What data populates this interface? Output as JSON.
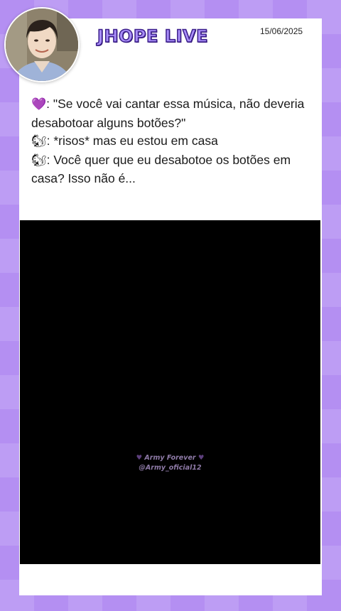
{
  "header": {
    "title": "JHOPE LIVE",
    "date": "15/06/2025"
  },
  "post": {
    "lines": [
      {
        "icon": "💜",
        "icon_name": "purple-heart-icon",
        "text": ": \"Se você vai cantar essa música, não deveria desabotoar alguns botões?\""
      },
      {
        "icon": "🐿",
        "icon_name": "squirrel-icon",
        "text": ": *risos* mas eu estou em casa"
      },
      {
        "icon": "🐿",
        "icon_name": "squirrel-icon",
        "text": ": Você quer que eu desabotoe os botões em casa? Isso não é..."
      }
    ]
  },
  "video": {
    "watermark_line1": "Army Forever",
    "watermark_heart": "♥",
    "watermark_line2": "@Army_oficial12"
  },
  "colors": {
    "background": "#b48ff2",
    "card": "#ffffff",
    "title_fill": "#a98ef8",
    "title_stroke": "#3a1d8a"
  }
}
